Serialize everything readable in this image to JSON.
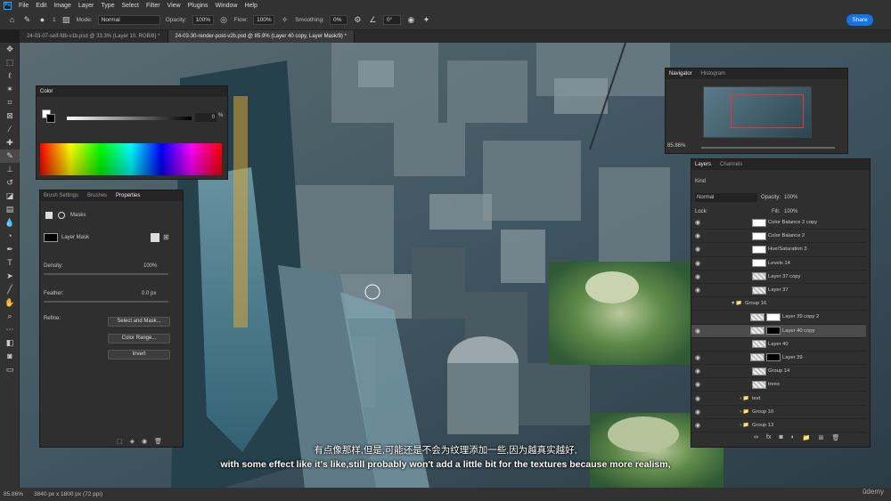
{
  "menu": {
    "items": [
      "File",
      "Edit",
      "Image",
      "Layer",
      "Type",
      "Select",
      "Filter",
      "View",
      "Plugins",
      "Window",
      "Help"
    ]
  },
  "options": {
    "mode_label": "Mode:",
    "mode_value": "Normal",
    "opacity_label": "Opacity:",
    "opacity_value": "100%",
    "flow_label": "Flow:",
    "flow_value": "100%",
    "smoothing_label": "Smoothing:",
    "smoothing_value": "0%",
    "angle_value": "0°",
    "brush_size": "1",
    "share_label": "Share"
  },
  "tabs": [
    "24-03-07-self-fdb-v1b.psd @ 33.3% (Layer 10, RGB/8) *",
    "24-03-30-render-post-v2b.psd @ 85.9% (Layer 40 copy, Layer Mask/8) *"
  ],
  "color_panel": {
    "title": "Color",
    "value": "0",
    "unit": "%"
  },
  "properties_panel": {
    "tabs": [
      "Brush Settings",
      "Brushes",
      "Properties"
    ],
    "section": "Masks",
    "mask_label": "Layer Mask",
    "density_label": "Density:",
    "density_value": "100%",
    "feather_label": "Feather:",
    "feather_value": "0.0 px",
    "refine_label": "Refine:",
    "btn_select_mask": "Select and Mask...",
    "btn_color_range": "Color Range...",
    "btn_invert": "Invert"
  },
  "navigator": {
    "tabs": [
      "Navigator",
      "Histogram"
    ],
    "zoom": "85.86%"
  },
  "layers_panel": {
    "tabs": [
      "Layers",
      "Channels"
    ],
    "kind_label": "Kind",
    "blend": "Normal",
    "opacity_label": "Opacity:",
    "opacity_value": "100%",
    "lock_label": "Lock:",
    "fill_label": "Fill:",
    "fill_value": "100%",
    "layers": [
      {
        "name": "Color Balance 2 copy"
      },
      {
        "name": "Color Balance 2"
      },
      {
        "name": "Hue/Saturation 3"
      },
      {
        "name": "Levels 14"
      },
      {
        "name": "Layer 37 copy"
      },
      {
        "name": "Layer 37"
      },
      {
        "name": "Group 16"
      },
      {
        "name": "Layer 39 copy 2"
      },
      {
        "name": "Layer 40 copy"
      },
      {
        "name": "Layer 40"
      },
      {
        "name": "Layer 39"
      },
      {
        "name": "Group 14"
      },
      {
        "name": "trees"
      },
      {
        "name": "text"
      },
      {
        "name": "Group 10"
      },
      {
        "name": "Group 13"
      }
    ]
  },
  "status": {
    "zoom": "85.86%",
    "doc_size": "3840 px x 1800 px (72 ppi)"
  },
  "subtitles": {
    "zh": "有点像那样,但是,可能还是不会为纹理添加一些,因为越真实越好,",
    "en": "with some effect like it's like,still probably won't add a little bit for the textures because more realism,"
  },
  "watermark": "ûdemy",
  "colors": {
    "accent": "#1473e6",
    "panel": "#2f2f2f",
    "selected_row": "#4b4b4b"
  }
}
